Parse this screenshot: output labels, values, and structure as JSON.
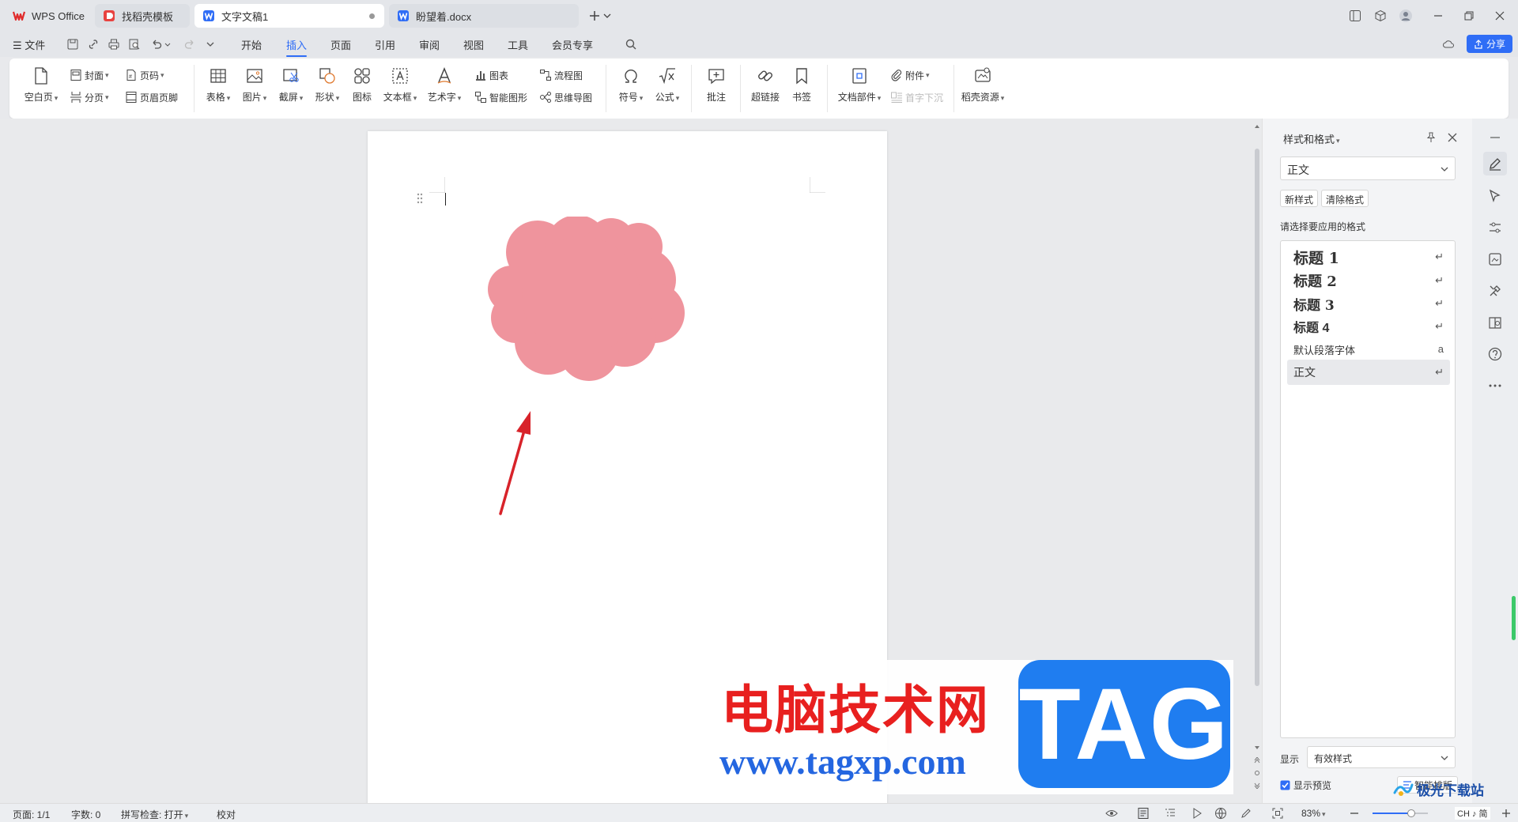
{
  "tabs": [
    {
      "label": "WPS Office",
      "icon": "wps-logo-icon"
    },
    {
      "label": "找稻壳模板",
      "icon": "docer-icon"
    },
    {
      "label": "文字文稿1",
      "icon": "word-doc-icon",
      "active": true
    },
    {
      "label": "盼望着.docx",
      "icon": "word-doc-icon"
    }
  ],
  "menu": {
    "file": "文件",
    "items": [
      "开始",
      "插入",
      "页面",
      "引用",
      "审阅",
      "视图",
      "工具",
      "会员专享"
    ],
    "active": "插入",
    "share": "分享"
  },
  "ribbon": {
    "blank_page": "空白页",
    "cover": "封面",
    "page_number": "页码",
    "page_break": "分页",
    "header_footer": "页眉页脚",
    "table": "表格",
    "picture": "图片",
    "screenshot": "截屏",
    "shape": "形状",
    "icon": "图标",
    "textbox": "文本框",
    "art_text": "艺术字",
    "chart": "图表",
    "smart_graphic": "智能图形",
    "flowchart": "流程图",
    "mindmap": "思维导图",
    "symbol": "符号",
    "formula": "公式",
    "comment": "批注",
    "hyperlink": "超链接",
    "bookmark": "书签",
    "doc_parts": "文档部件",
    "attachment": "附件",
    "drop_cap": "首字下沉",
    "docer_resources": "稻壳资源"
  },
  "panel": {
    "title": "样式和格式",
    "current_style": "正文",
    "new_style": "新样式",
    "clear_format": "清除格式",
    "choose_label": "请选择要应用的格式",
    "styles": [
      {
        "name": "标题  1",
        "mark": "↵"
      },
      {
        "name": "标题  2",
        "mark": "↵"
      },
      {
        "name": "标题  3",
        "mark": "↵"
      },
      {
        "name": "标题 4",
        "mark": "↵"
      },
      {
        "name": "默认段落字体",
        "mark": "a"
      },
      {
        "name": "正文",
        "mark": "↵"
      }
    ],
    "show_label": "显示",
    "show_value": "有效样式",
    "show_preview": "显示预览",
    "smart_layout": "智能排版"
  },
  "statusbar": {
    "page": "页面: 1/1",
    "words": "字数: 0",
    "spellcheck": "拼写检查: 打开",
    "proof": "校对",
    "zoom": "83%",
    "ime": "CH ♪ 简"
  },
  "watermark": {
    "site_name": "电脑技术网",
    "site_url": "www.tagxp.com",
    "tag": "TAG",
    "corner": "极光下载站"
  },
  "colors": {
    "accent": "#2f6df6",
    "cloud_fill": "#ef949d",
    "arrow": "#d8232a",
    "watermark_red": "#e8201f",
    "watermark_blue": "#1f7df0"
  }
}
